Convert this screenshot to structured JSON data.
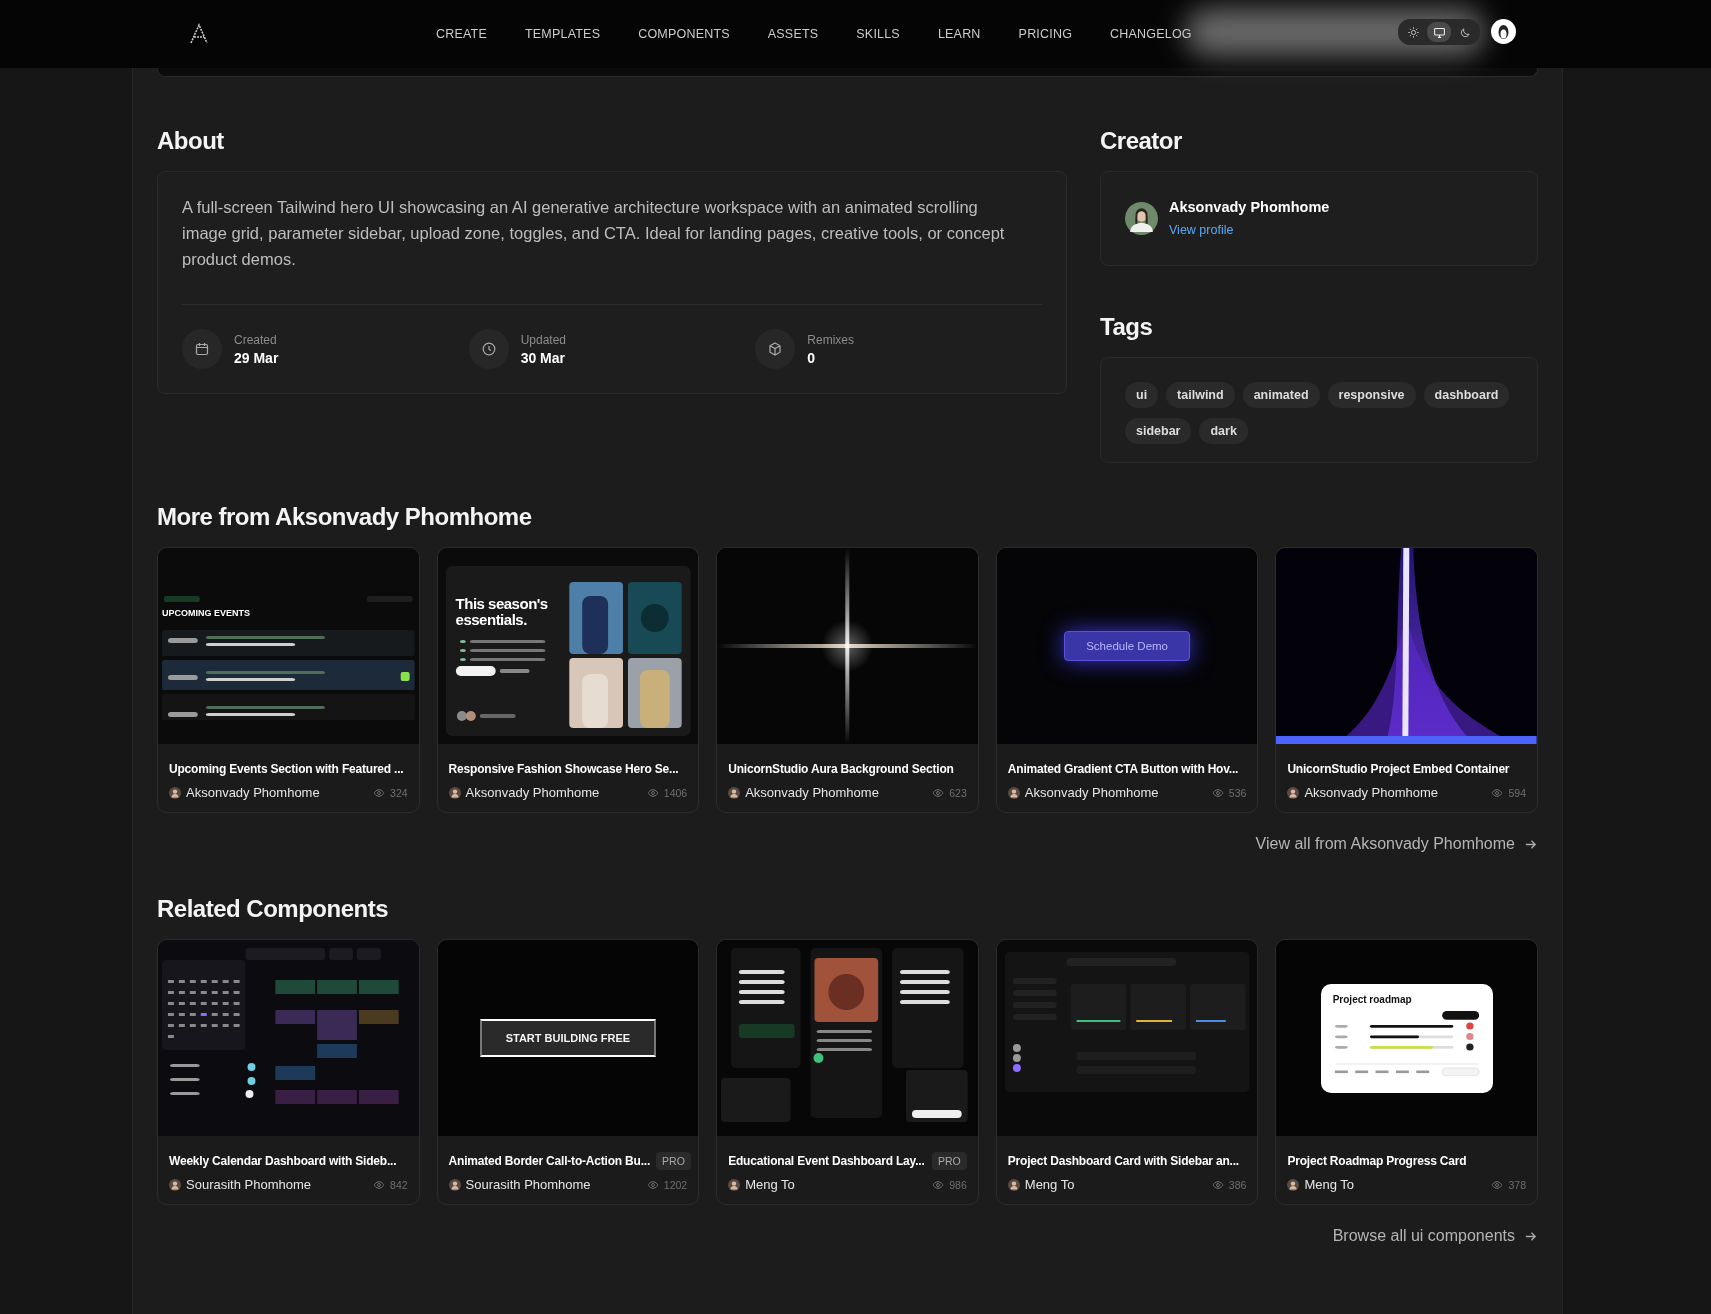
{
  "nav": {
    "items": [
      "CREATE",
      "TEMPLATES",
      "COMPONENTS",
      "ASSETS",
      "SKILLS",
      "LEARN",
      "PRICING",
      "CHANGELOG"
    ]
  },
  "theme_toggle": [
    {
      "kind": "sun",
      "selected": false
    },
    {
      "kind": "monitor",
      "selected": true
    },
    {
      "kind": "moon",
      "selected": false
    }
  ],
  "about": {
    "heading": "About",
    "description": "A full-screen Tailwind hero UI showcasing an AI generative architecture workspace with an animated scrolling image grid, parameter sidebar, upload zone, toggles, and CTA. Ideal for landing pages, creative tools, or concept product demos.",
    "stats": [
      {
        "kind": "calendar",
        "label": "Created",
        "value": "29 Mar"
      },
      {
        "kind": "clock",
        "label": "Updated",
        "value": "30 Mar"
      },
      {
        "kind": "cube",
        "label": "Remixes",
        "value": "0"
      }
    ]
  },
  "creator": {
    "heading": "Creator",
    "name": "Aksonvady Phomhome",
    "link": "View profile"
  },
  "tags": {
    "heading": "Tags",
    "items": [
      "ui",
      "tailwind",
      "animated",
      "responsive",
      "dashboard",
      "sidebar",
      "dark"
    ]
  },
  "more": {
    "heading": "More from Aksonvady Phomhome",
    "cards": [
      {
        "title": "Upcoming Events Section with Featured ...",
        "author": "Aksonvady Phomhome",
        "views": "324",
        "preview": {
          "kind": "events",
          "headline": "UPCOMING EVENTS"
        }
      },
      {
        "title": "Responsive Fashion Showcase Hero Se...",
        "author": "Aksonvady Phomhome",
        "views": "1406",
        "preview": {
          "kind": "fashion",
          "headline": "This season's essentials."
        }
      },
      {
        "title": "UnicornStudio Aura Background Section",
        "author": "Aksonvady Phomhome",
        "views": "623",
        "preview": {
          "kind": "flare"
        }
      },
      {
        "title": "Animated Gradient CTA Button with Hov...",
        "author": "Aksonvady Phomhome",
        "views": "536",
        "preview": {
          "kind": "glow-button",
          "headline": "Schedule Demo"
        }
      },
      {
        "title": "UnicornStudio Project Embed Container",
        "author": "Aksonvady Phomhome",
        "views": "594",
        "preview": {
          "kind": "beam"
        }
      }
    ],
    "link": "View all from Aksonvady Phomhome"
  },
  "related": {
    "heading": "Related Components",
    "cards": [
      {
        "title": "Weekly Calendar Dashboard with Sideb...",
        "author": "Sourasith Phomhome",
        "views": "842",
        "preview": {
          "kind": "calendar"
        }
      },
      {
        "title": "Animated Border Call-to-Action Bu...",
        "badge": "PRO",
        "author": "Sourasith Phomhome",
        "views": "1202",
        "preview": {
          "kind": "border-button",
          "headline": "START BUILDING FREE"
        }
      },
      {
        "title": "Educational Event Dashboard Lay...",
        "badge": "PRO",
        "author": "Meng To",
        "views": "986",
        "preview": {
          "kind": "panels"
        }
      },
      {
        "title": "Project Dashboard Card with Sidebar an...",
        "author": "Meng To",
        "views": "386",
        "preview": {
          "kind": "dashboard"
        }
      },
      {
        "title": "Project Roadmap Progress Card",
        "author": "Meng To",
        "views": "378",
        "preview": {
          "kind": "roadmap",
          "headline": "Project roadmap"
        }
      }
    ],
    "link": "Browse all ui components"
  }
}
